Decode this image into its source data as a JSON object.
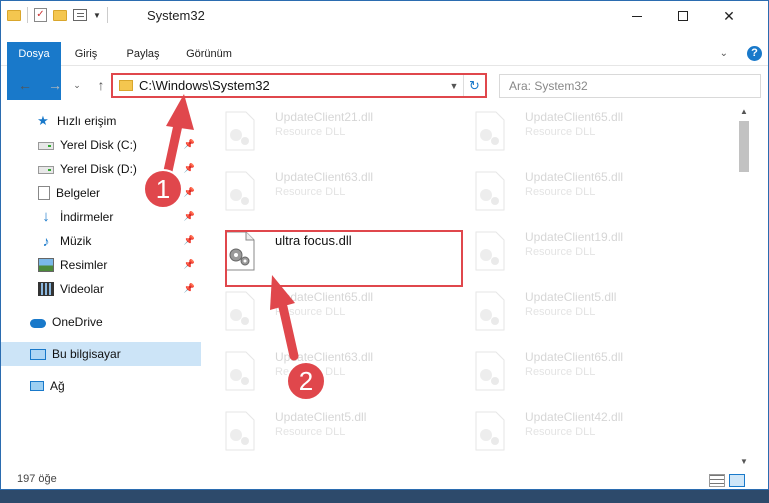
{
  "window": {
    "title": "System32",
    "colors": {
      "accent": "#1979ca",
      "annotation": "#e0474c",
      "selection": "#cce4f7"
    }
  },
  "ribbon": {
    "tabs": [
      "Dosya",
      "Giriş",
      "Paylaş",
      "Görünüm"
    ],
    "help_label": "?"
  },
  "navigation": {
    "back_icon": "arrow-left-icon",
    "forward_icon": "arrow-right-icon",
    "up_icon": "arrow-up-icon",
    "address_path": "C:\\Windows\\System32",
    "search_placeholder": "Ara: System32"
  },
  "sidebar": {
    "items": [
      {
        "label": "Hızlı erişim",
        "icon": "star-icon",
        "pinned": false
      },
      {
        "label": "Yerel Disk (C:)",
        "icon": "drive-icon",
        "pinned": true
      },
      {
        "label": "Yerel Disk (D:)",
        "icon": "drive-icon",
        "pinned": true
      },
      {
        "label": "Belgeler",
        "icon": "document-icon",
        "pinned": true
      },
      {
        "label": "İndirmeler",
        "icon": "download-icon",
        "pinned": true
      },
      {
        "label": "Müzik",
        "icon": "music-icon",
        "pinned": true
      },
      {
        "label": "Resimler",
        "icon": "pictures-icon",
        "pinned": true
      },
      {
        "label": "Videolar",
        "icon": "video-icon",
        "pinned": true
      },
      {
        "label": "OneDrive",
        "icon": "cloud-icon",
        "pinned": false
      },
      {
        "label": "Bu bilgisayar",
        "icon": "computer-icon",
        "pinned": false,
        "selected": true
      },
      {
        "label": "Ağ",
        "icon": "network-icon",
        "pinned": false
      }
    ]
  },
  "files": [
    {
      "name": "UpdateClient21.dll",
      "type": "Resource DLL"
    },
    {
      "name": "UpdateClient65.dll",
      "type": "Resource DLL"
    },
    {
      "name": "UpdateClient63.dll",
      "type": "Resource DLL"
    },
    {
      "name": "UpdateClient65.dll",
      "type": "Resource DLL"
    },
    {
      "name": "ultra focus.dll",
      "type": ""
    },
    {
      "name": "UpdateClient19.dll",
      "type": "Resource DLL"
    },
    {
      "name": "UpdateClient65.dll",
      "type": "Resource DLL"
    },
    {
      "name": "UpdateClient5.dll",
      "type": "Resource DLL"
    },
    {
      "name": "UpdateClient63.dll",
      "type": "Resource DLL"
    },
    {
      "name": "UpdateClient65.dll",
      "type": "Resource DLL"
    },
    {
      "name": "UpdateClient5.dll",
      "type": "Resource DLL"
    },
    {
      "name": "UpdateClient42.dll",
      "type": "Resource DLL"
    }
  ],
  "status": {
    "item_count": "197 öğe"
  },
  "annotations": {
    "step1": "1",
    "step2": "2"
  }
}
